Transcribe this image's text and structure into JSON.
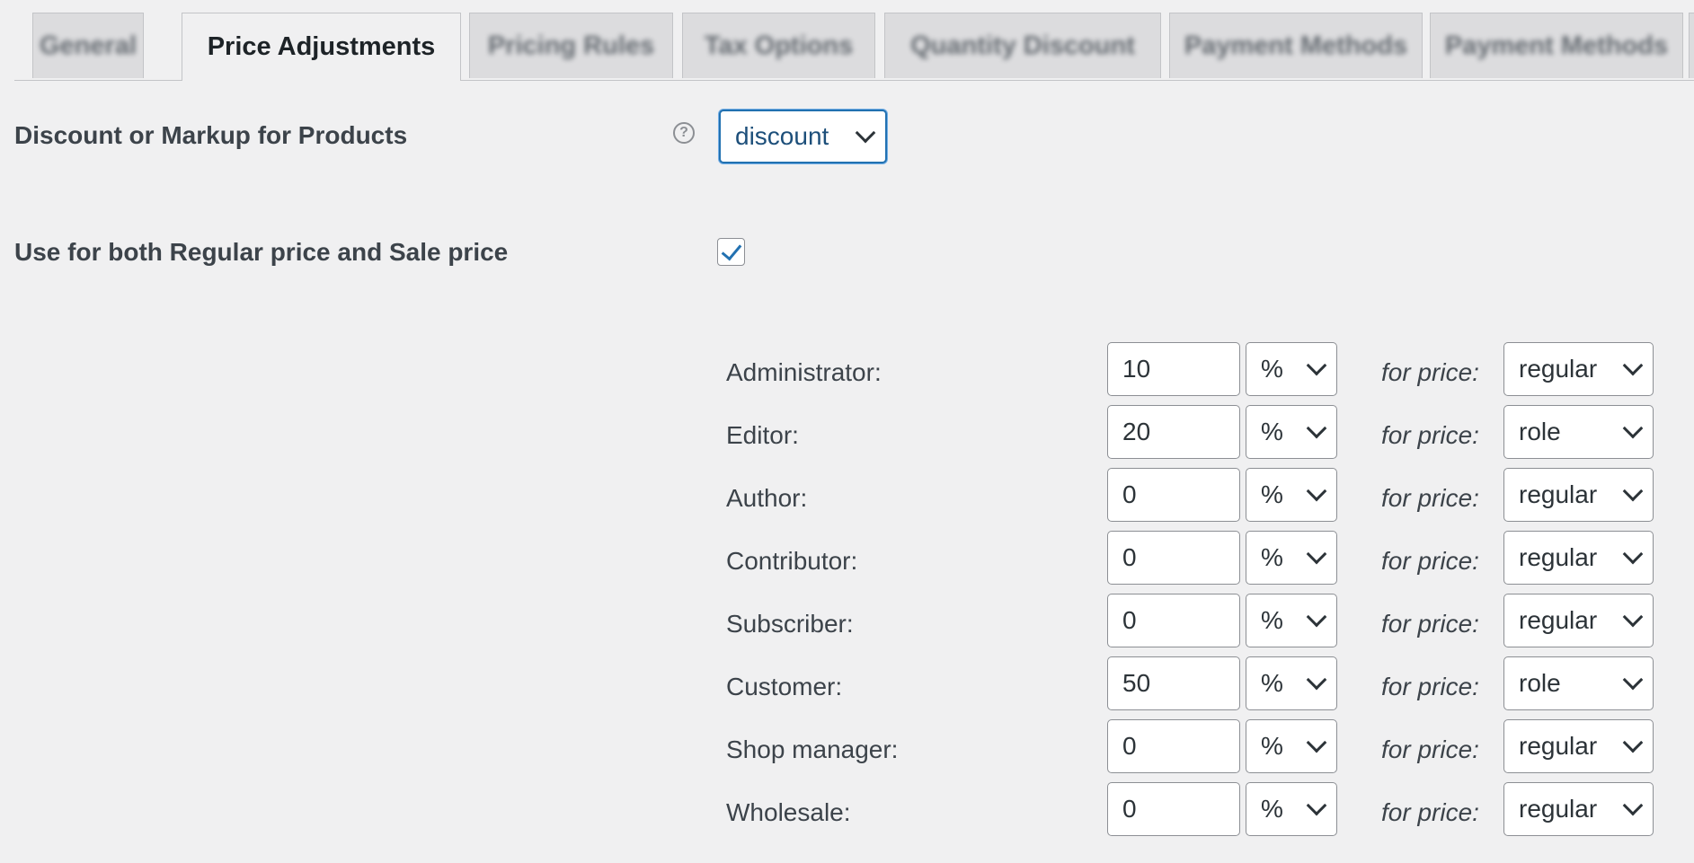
{
  "tabs": [
    {
      "label": "General",
      "blurred": true
    },
    {
      "label": "Price Adjustments",
      "blurred": false,
      "active": true
    },
    {
      "label": "Pricing Rules",
      "blurred": true
    },
    {
      "label": "Tax Options",
      "blurred": true
    },
    {
      "label": "Quantity Discount",
      "blurred": true
    },
    {
      "label": "Payment Methods",
      "blurred": true
    },
    {
      "label": "Payment Methods",
      "blurred": true
    }
  ],
  "discount_markup": {
    "label": "Discount or Markup for Products",
    "help_icon": "question-circle-icon",
    "value": "discount"
  },
  "regular_sale": {
    "label": "Use for both Regular price and Sale price",
    "checked": true
  },
  "for_price_label": "for price:",
  "roles": [
    {
      "label": "Administrator:",
      "amount": "10",
      "unit": "%",
      "price": "regular"
    },
    {
      "label": "Editor:",
      "amount": "20",
      "unit": "%",
      "price": "role"
    },
    {
      "label": "Author:",
      "amount": "0",
      "unit": "%",
      "price": "regular"
    },
    {
      "label": "Contributor:",
      "amount": "0",
      "unit": "%",
      "price": "regular"
    },
    {
      "label": "Subscriber:",
      "amount": "0",
      "unit": "%",
      "price": "regular"
    },
    {
      "label": "Customer:",
      "amount": "50",
      "unit": "%",
      "price": "role"
    },
    {
      "label": "Shop manager:",
      "amount": "0",
      "unit": "%",
      "price": "regular"
    },
    {
      "label": "Wholesale:",
      "amount": "0",
      "unit": "%",
      "price": "regular"
    }
  ],
  "colors": {
    "accent": "#2271b1",
    "background": "#f0f0f1"
  }
}
